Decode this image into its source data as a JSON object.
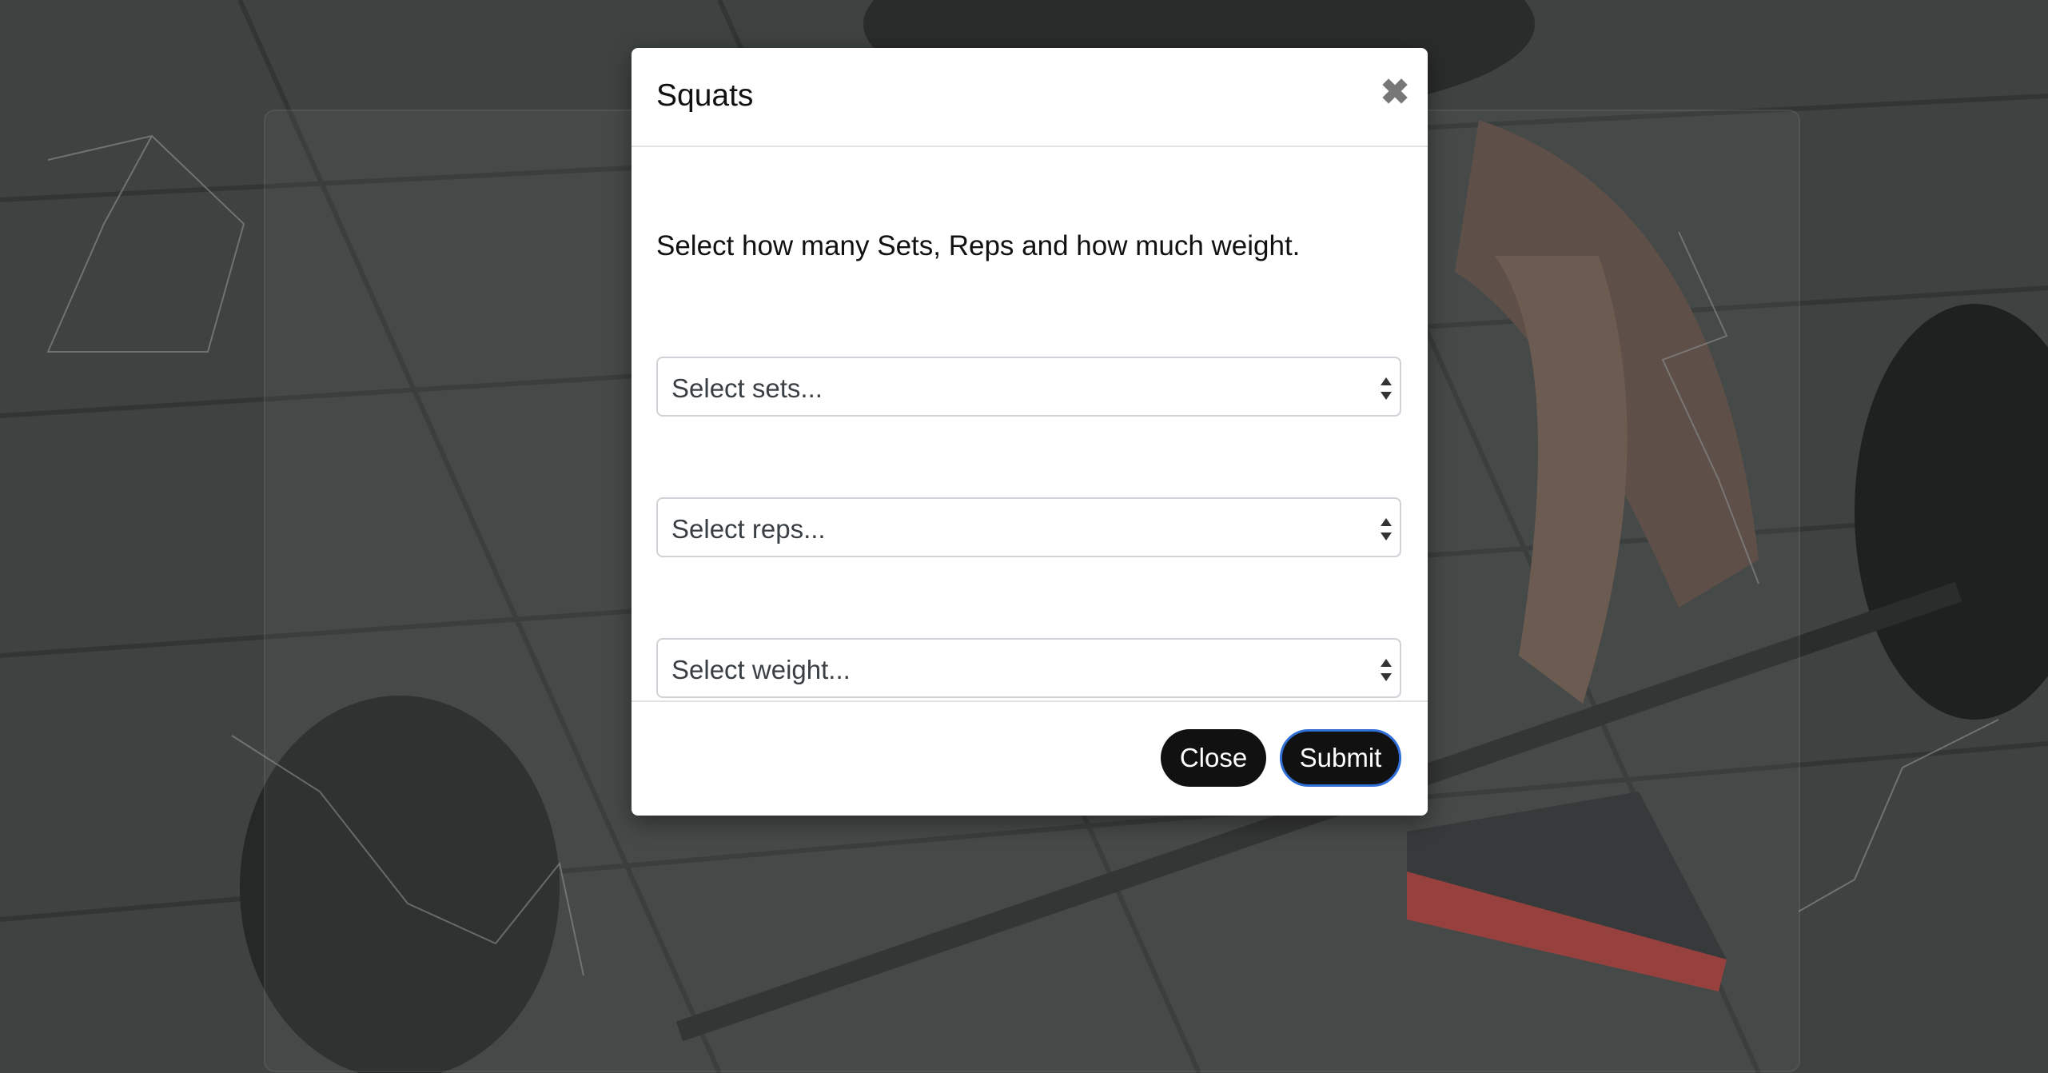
{
  "modal": {
    "title": "Squats",
    "close_icon": "close-icon",
    "instructions": "Select how many Sets, Reps and how much weight.",
    "selects": {
      "sets_placeholder": "Select sets...",
      "reps_placeholder": "Select reps...",
      "weight_placeholder": "Select weight..."
    },
    "buttons": {
      "close_label": "Close",
      "submit_label": "Submit"
    }
  },
  "colors": {
    "button_bg": "#111111",
    "submit_border": "#2f6fd6",
    "modal_bg": "#ffffff",
    "overlay": "#3b3f3d"
  }
}
